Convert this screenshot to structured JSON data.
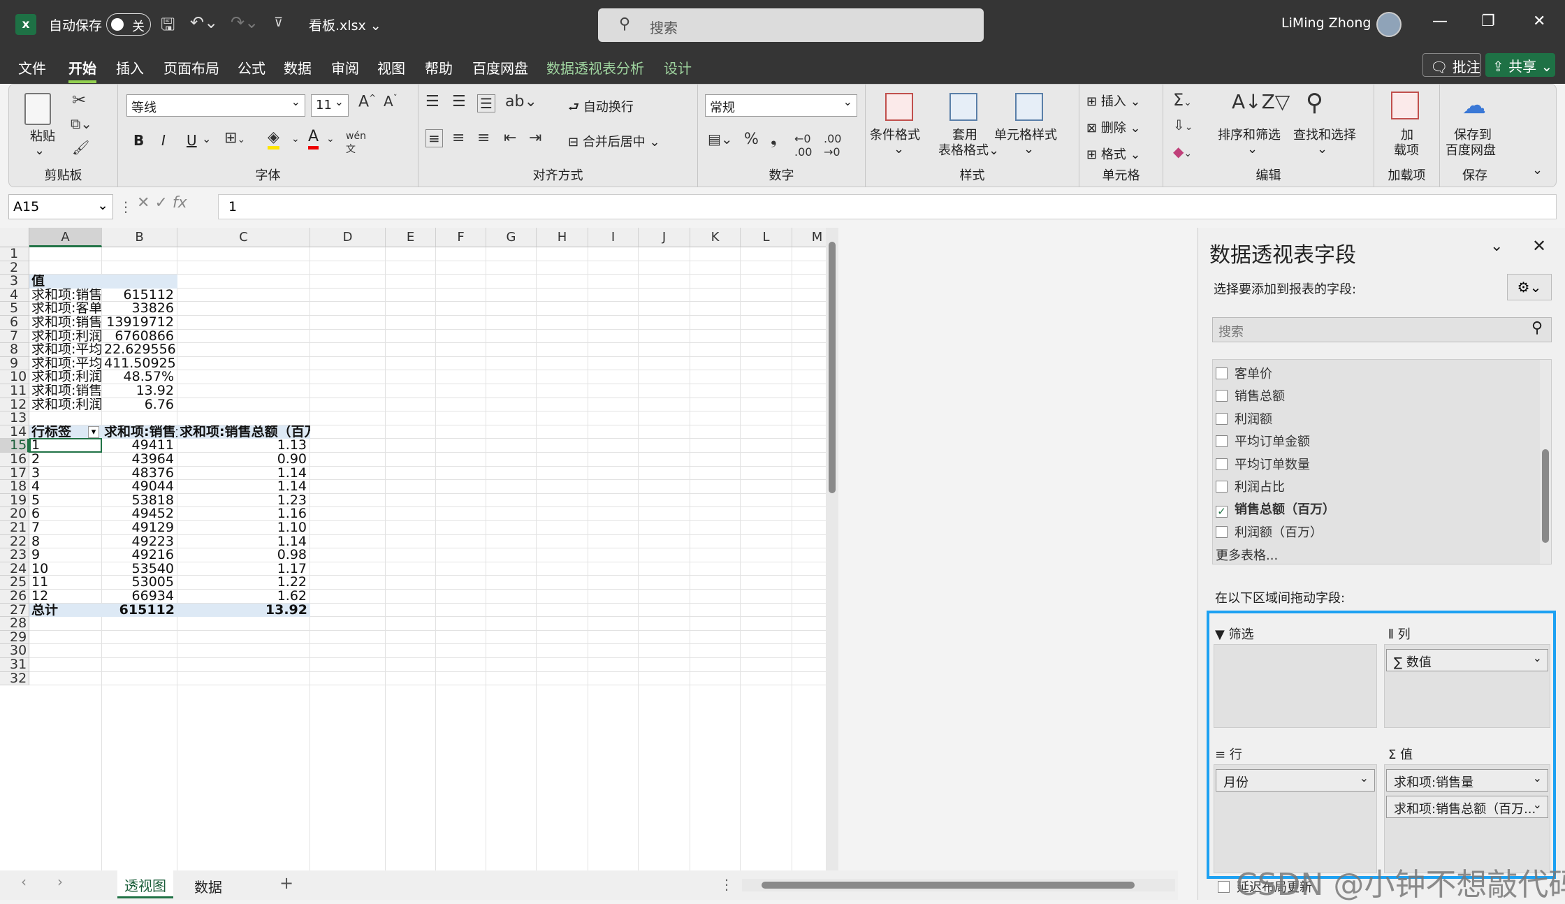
{
  "titlebar": {
    "autosave_label": "自动保存",
    "autosave_state": "关",
    "filename": "看板.xlsx",
    "search_placeholder": "搜索",
    "user": "LiMing Zhong"
  },
  "menu": {
    "items": [
      "文件",
      "开始",
      "插入",
      "页面布局",
      "公式",
      "数据",
      "审阅",
      "视图",
      "帮助",
      "百度网盘",
      "数据透视表分析",
      "设计"
    ],
    "active": "开始",
    "comment_btn": "批注",
    "share_btn": "共享"
  },
  "ribbon": {
    "clipboard": {
      "paste": "粘贴",
      "label": "剪贴板"
    },
    "font": {
      "family": "等线",
      "size": "11",
      "label": "字体",
      "bold": "B",
      "italic": "I",
      "underline": "U"
    },
    "align": {
      "wrap": "自动换行",
      "merge": "合并后居中",
      "label": "对齐方式"
    },
    "number": {
      "format": "常规",
      "label": "数字",
      "percent": "%"
    },
    "styles": {
      "cond": "条件格式",
      "table_l1": "套用",
      "table_l2": "表格格式",
      "cell": "单元格样式",
      "label": "样式"
    },
    "cells": {
      "insert": "插入",
      "delete": "删除",
      "format": "格式",
      "label": "单元格"
    },
    "edit": {
      "sort": "排序和筛选",
      "find": "查找和选择",
      "label": "编辑"
    },
    "addin": {
      "l1": "加",
      "l2": "载项",
      "label": "加载项"
    },
    "save": {
      "l1": "保存到",
      "l2": "百度网盘",
      "label": "保存"
    }
  },
  "formula": {
    "namebox": "A15",
    "fx": "fx",
    "value": "1"
  },
  "columns": [
    "A",
    "B",
    "C",
    "D",
    "E",
    "F",
    "G",
    "H",
    "I",
    "J",
    "K",
    "L",
    "M"
  ],
  "rows": [
    "1",
    "2",
    "3",
    "4",
    "5",
    "6",
    "7",
    "8",
    "9",
    "10",
    "11",
    "12",
    "13",
    "14",
    "15",
    "16",
    "17",
    "18",
    "19",
    "20",
    "21",
    "22",
    "23",
    "24",
    "25",
    "26",
    "27",
    "28",
    "29",
    "30",
    "31",
    "32"
  ],
  "values_block": {
    "header": "值",
    "labels": [
      "求和项:销售",
      "求和项:客单",
      "求和项:销售",
      "求和项:利润",
      "求和项:平均",
      "求和项:平均",
      "求和项:利润",
      "求和项:销售",
      "求和项:利润"
    ],
    "values": [
      "615112",
      "33826",
      "13919712",
      "6760866",
      "22.62955689",
      "411.5092532",
      "48.57%",
      "13.92",
      "6.76"
    ]
  },
  "pivot": {
    "headers": [
      "行标签",
      "求和项:销售量",
      "求和项:销售总额（百万）"
    ],
    "rows": [
      [
        "1",
        "49411",
        "1.13"
      ],
      [
        "2",
        "43964",
        "0.90"
      ],
      [
        "3",
        "48376",
        "1.14"
      ],
      [
        "4",
        "49044",
        "1.14"
      ],
      [
        "5",
        "53818",
        "1.23"
      ],
      [
        "6",
        "49452",
        "1.16"
      ],
      [
        "7",
        "49129",
        "1.10"
      ],
      [
        "8",
        "49223",
        "1.14"
      ],
      [
        "9",
        "49216",
        "0.98"
      ],
      [
        "10",
        "53540",
        "1.17"
      ],
      [
        "11",
        "53005",
        "1.22"
      ],
      [
        "12",
        "66934",
        "1.62"
      ]
    ],
    "total": [
      "总计",
      "615112",
      "13.92"
    ]
  },
  "sheet_tabs": [
    "透视图",
    "数据"
  ],
  "active_tab": "透视图",
  "pane": {
    "title": "数据透视表字段",
    "subtitle": "选择要添加到报表的字段:",
    "search_placeholder": "搜索",
    "fields": [
      {
        "name": "客单价",
        "checked": false
      },
      {
        "name": "销售总额",
        "checked": false
      },
      {
        "name": "利润额",
        "checked": false
      },
      {
        "name": "平均订单金额",
        "checked": false
      },
      {
        "name": "平均订单数量",
        "checked": false
      },
      {
        "name": "利润占比",
        "checked": false
      },
      {
        "name": "销售总额（百万）",
        "checked": true
      },
      {
        "name": "利润额（百万）",
        "checked": false
      }
    ],
    "more_tables": "更多表格...",
    "drag_hint": "在以下区域间拖动字段:",
    "filter_label": "筛选",
    "columns_label": "列",
    "rows_label": "行",
    "values_label": "值",
    "columns_item": "∑ 数值",
    "rows_item": "月份",
    "values_items": [
      "求和项:销售量",
      "求和项:销售总额（百万..."
    ],
    "defer_label": "延迟布局更新"
  },
  "watermark": "CSDN @小钟不想敲代码"
}
